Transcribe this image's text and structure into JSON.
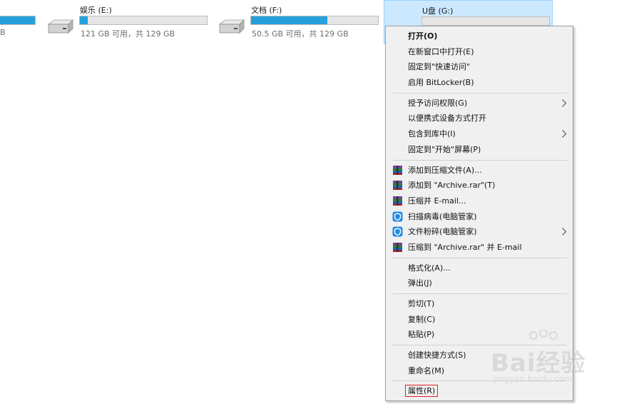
{
  "drives": [
    {
      "id": "d",
      "label": "",
      "capacity": "B",
      "used_fraction": 1.0
    },
    {
      "id": "e",
      "label": "娱乐 (E:)",
      "capacity": "121 GB 可用，共 129 GB",
      "used_fraction": 0.06
    },
    {
      "id": "f",
      "label": "文档 (F:)",
      "capacity": "50.5 GB 可用，共 129 GB",
      "used_fraction": 0.6
    },
    {
      "id": "g",
      "label": "U盘 (G:)",
      "capacity": "",
      "used_fraction": 0.0
    }
  ],
  "context_menu": {
    "items": [
      {
        "label": "打开(O)",
        "bold": true
      },
      {
        "label": "在新窗口中打开(E)"
      },
      {
        "label": "固定到\"快速访问\""
      },
      {
        "label": "启用 BitLocker(B)"
      },
      {
        "label": "授予访问权限(G)",
        "submenu": true
      },
      {
        "label": "以便携式设备方式打开"
      },
      {
        "label": "包含到库中(I)",
        "submenu": true
      },
      {
        "label": "固定到\"开始\"屏幕(P)"
      },
      {
        "label": "添加到压缩文件(A)...",
        "icon": "winrar-icon"
      },
      {
        "label": "添加到 \"Archive.rar\"(T)",
        "icon": "winrar-icon"
      },
      {
        "label": "压缩并 E-mail...",
        "icon": "winrar-icon"
      },
      {
        "label": "扫描病毒(电脑管家)",
        "icon": "shield-icon"
      },
      {
        "label": "文件粉碎(电脑管家)",
        "icon": "shield-icon",
        "submenu": true
      },
      {
        "label": "压缩到 \"Archive.rar\" 并 E-mail",
        "icon": "winrar-icon"
      },
      {
        "label": "格式化(A)..."
      },
      {
        "label": "弹出(J)"
      },
      {
        "label": "剪切(T)"
      },
      {
        "label": "复制(C)"
      },
      {
        "label": "粘贴(P)"
      },
      {
        "label": "创建快捷方式(S)"
      },
      {
        "label": "重命名(M)"
      },
      {
        "label": "属性(R)",
        "highlight": true
      }
    ]
  },
  "watermark": {
    "text": "Bai经验",
    "sub": "jingyan.baidu.com"
  },
  "colors": {
    "bar_fill": "#26a0da",
    "selection_bg": "#cce8ff",
    "highlight_border": "#e0202a"
  }
}
